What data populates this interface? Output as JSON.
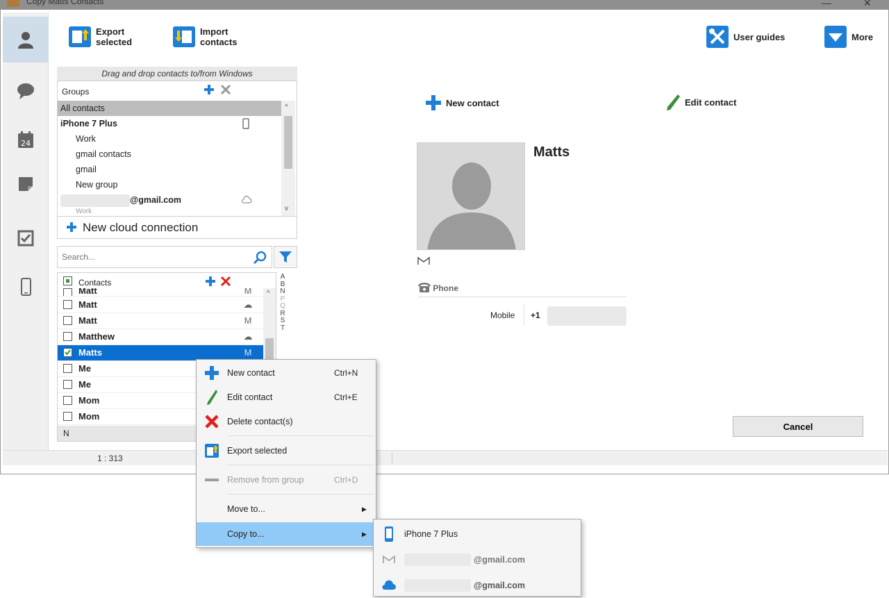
{
  "window": {
    "title": "Copy Matts Contacts",
    "minimize": "—",
    "close": "✕"
  },
  "toolbar": {
    "export_label_1": "Export",
    "export_label_2": "selected",
    "import_label_1": "Import",
    "import_label_2": "contacts",
    "user_guides_label": "User guides",
    "more_label": "More"
  },
  "groups": {
    "dnd_hint": "Drag and drop contacts to/from Windows",
    "header": "Groups",
    "items": [
      {
        "label": "All contacts"
      },
      {
        "label": "iPhone 7 Plus"
      },
      {
        "label": "Work"
      },
      {
        "label": "gmail contacts"
      },
      {
        "label": "gmail"
      },
      {
        "label": "New group"
      },
      {
        "label": "@gmail.com"
      },
      {
        "label": "Work"
      }
    ],
    "new_cloud_label": "New cloud connection"
  },
  "search": {
    "placeholder": "Search..."
  },
  "contacts": {
    "header": "Contacts",
    "rows": [
      {
        "name": "Matt",
        "svc": "M"
      },
      {
        "name": "Matt",
        "svc": "☁"
      },
      {
        "name": "Matt",
        "svc": "M"
      },
      {
        "name": "Matthew",
        "svc": "☁"
      },
      {
        "name": "Matts",
        "svc": "M"
      },
      {
        "name": "Me",
        "svc": ""
      },
      {
        "name": "Me",
        "svc": ""
      },
      {
        "name": "Mom",
        "svc": ""
      },
      {
        "name": "Mom",
        "svc": ""
      }
    ],
    "current_letter": "N",
    "alphabet": [
      "A",
      "B",
      "N",
      "P",
      "Q",
      "R",
      "S",
      "T"
    ]
  },
  "status": {
    "count": "1 : 313"
  },
  "detail": {
    "new_contact_label": "New contact",
    "edit_contact_label": "Edit contact",
    "name": "Matts",
    "phone_section": "Phone",
    "phone_type": "Mobile",
    "phone_prefix": "+1",
    "cancel_label": "Cancel"
  },
  "context_menu": {
    "items": [
      {
        "label": "New contact",
        "shortcut": "Ctrl+N"
      },
      {
        "label": "Edit contact",
        "shortcut": "Ctrl+E"
      },
      {
        "label": "Delete contact(s)",
        "shortcut": ""
      },
      {
        "label": "Export selected",
        "shortcut": ""
      },
      {
        "label": "Remove from group",
        "shortcut": "Ctrl+D"
      },
      {
        "label": "Move to...",
        "shortcut": ""
      },
      {
        "label": "Copy to...",
        "shortcut": ""
      }
    ]
  },
  "submenu": {
    "items": [
      {
        "label": "iPhone 7 Plus"
      },
      {
        "label": "@gmail.com"
      },
      {
        "label": "@gmail.com"
      }
    ]
  },
  "colors": {
    "accent": "#0b6fd1",
    "menu_highlight": "#91c9f7",
    "green_icon": "#3c8f3c",
    "delete_red": "#e0201b"
  }
}
